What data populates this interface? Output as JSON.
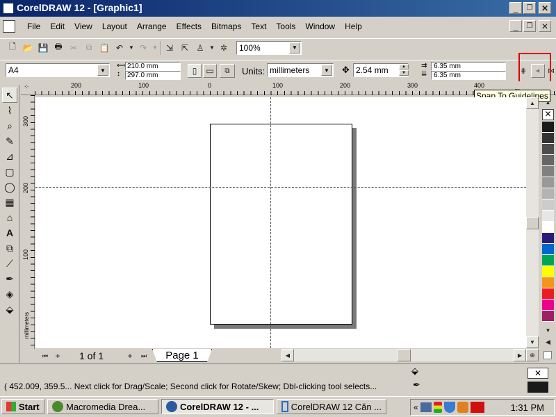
{
  "window": {
    "title": "CorelDRAW 12 - [Graphic1]"
  },
  "menu": [
    "File",
    "Edit",
    "View",
    "Layout",
    "Arrange",
    "Effects",
    "Bitmaps",
    "Text",
    "Tools",
    "Window",
    "Help"
  ],
  "toolbar": {
    "zoom": "100%"
  },
  "property_bar": {
    "paper": "A4",
    "width": "210.0 mm",
    "height": "297.0 mm",
    "units_label": "Units:",
    "units": "millimeters",
    "nudge": "2.54 mm",
    "dup_x": "6.35 mm",
    "dup_y": "6.35 mm"
  },
  "tooltip": "Snap To Guidelines",
  "ruler": {
    "h_labels": [
      "200",
      "100",
      "0",
      "100",
      "200",
      "300",
      "400"
    ],
    "h_unit": "millimeters",
    "v_labels": [
      "300",
      "200",
      "100"
    ],
    "v_unit": "millimeters"
  },
  "page_nav": {
    "count": "1 of 1",
    "tab": "Page 1"
  },
  "status": {
    "text": "( 452.009, 359.5...   Next click for Drag/Scale; Second click for Rotate/Skew; Dbl-clicking tool selects..."
  },
  "palette": [
    "#ffffff",
    "#1a1a1a",
    "#333333",
    "#4d4d4d",
    "#666666",
    "#808080",
    "#999999",
    "#b3b3b3",
    "#cccccc",
    "#e6e6e6",
    "#ffffff",
    "#2b1a7a",
    "#0066cc",
    "#00a651",
    "#ffff00",
    "#f7941d",
    "#ed1c24",
    "#ec008c",
    "#9e1f63"
  ],
  "taskbar": {
    "start": "Start",
    "tasks": [
      "Macromedia Drea...",
      "CorelDRAW 12 - ...",
      "CorelDRAW 12 Căn ..."
    ],
    "clock": "1:31 PM"
  }
}
